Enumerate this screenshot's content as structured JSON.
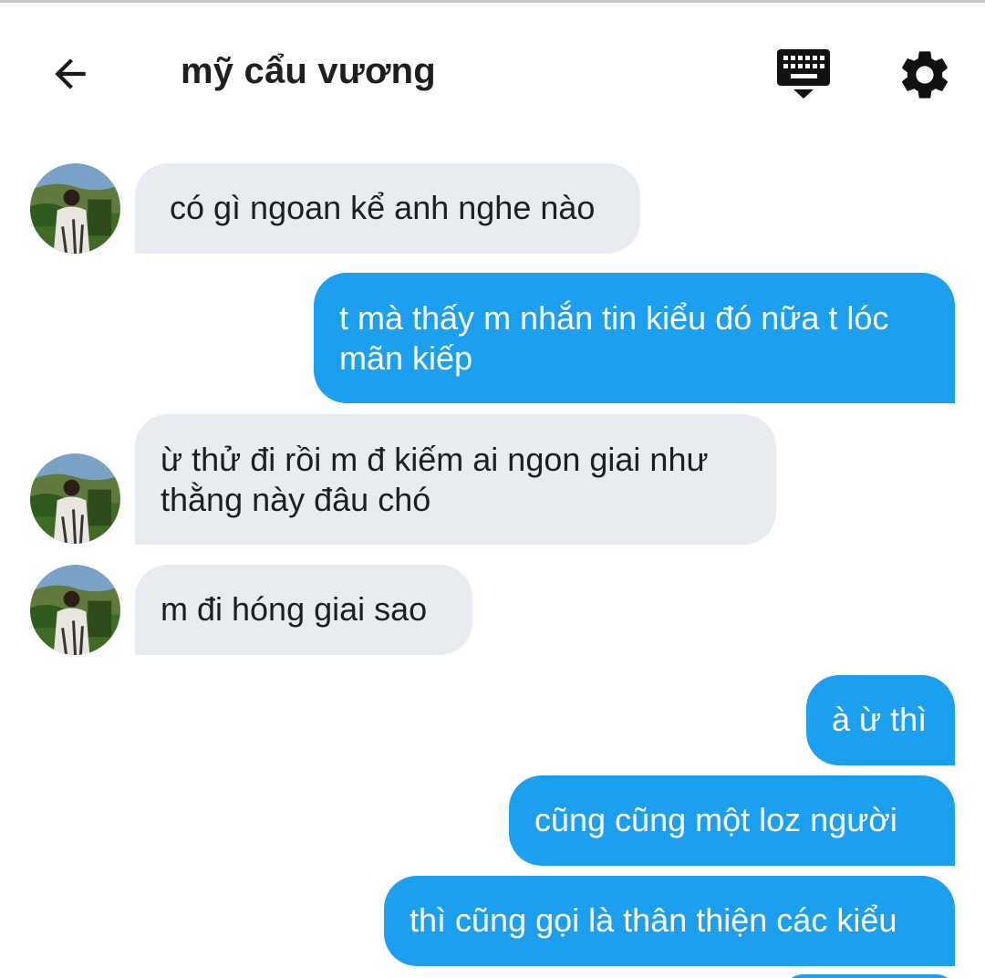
{
  "header": {
    "title": "mỹ cẩu vương",
    "back_icon": "arrow-left-icon",
    "keyboard_icon": "keyboard-icon",
    "settings_icon": "gear-icon"
  },
  "colors": {
    "incoming_bubble": "#e8ebef",
    "outgoing_bubble": "#1d9ff0",
    "text_dark": "#1c1e21"
  },
  "messages": [
    {
      "direction": "incoming",
      "lines": [
        "có gì ngoan kể anh nghe nào"
      ]
    },
    {
      "direction": "outgoing",
      "lines": [
        "t mà thấy m nhắn tin kiểu đó nữa t lóc",
        "mãn kiếp"
      ]
    },
    {
      "direction": "incoming",
      "lines": [
        "ừ thử đi rồi m đ kiếm ai ngon giai như",
        "thằng này đâu chó"
      ]
    },
    {
      "direction": "incoming",
      "lines": [
        "m đi hóng giai sao"
      ]
    },
    {
      "direction": "outgoing",
      "lines": [
        "à ừ thì"
      ]
    },
    {
      "direction": "outgoing",
      "lines": [
        "cũng cũng một loz người"
      ]
    },
    {
      "direction": "outgoing",
      "lines": [
        "thì cũng gọi là thân thiện các kiểu"
      ]
    }
  ]
}
